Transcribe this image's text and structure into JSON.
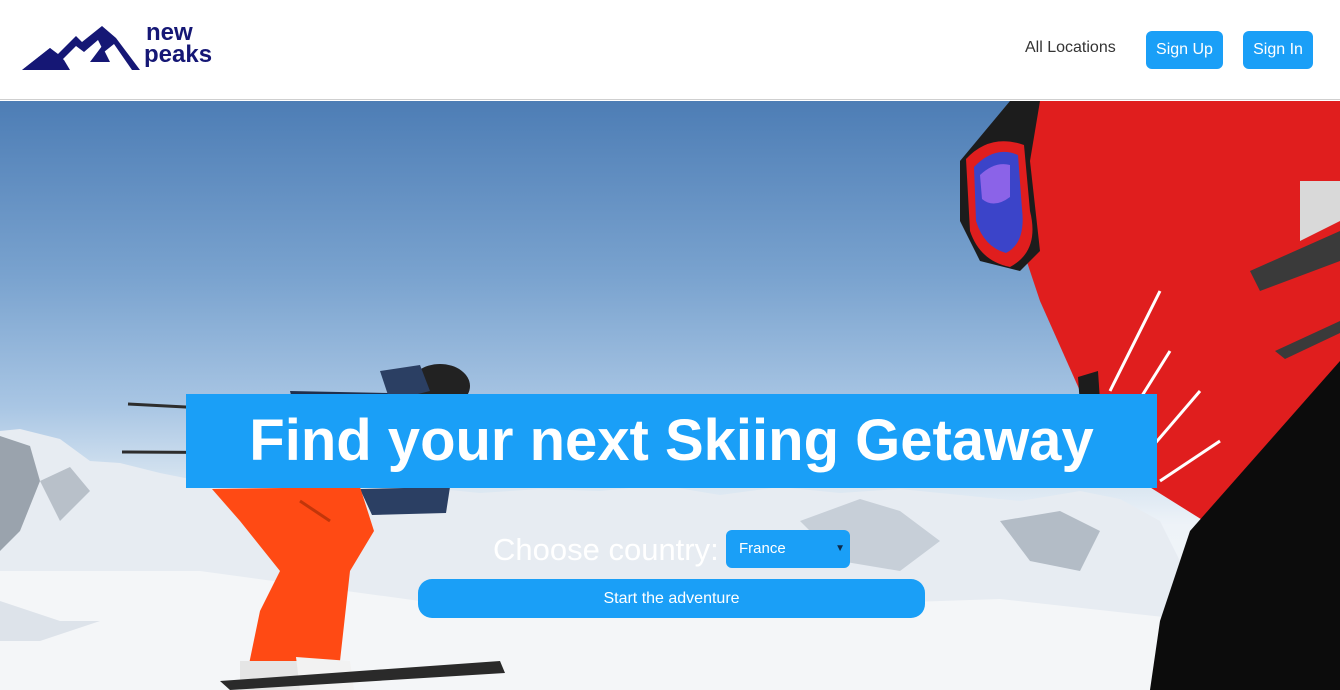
{
  "brand": {
    "line1": "new",
    "line2": "peaks",
    "color": "#151775",
    "icon": "mountain-logo"
  },
  "nav": {
    "all_locations": "All Locations",
    "sign_up": "Sign Up",
    "sign_in": "Sign In"
  },
  "hero": {
    "headline": "Find your next Skiing Getaway",
    "choose_label": "Choose country:",
    "country_selected": "France",
    "start_button": "Start the adventure"
  },
  "colors": {
    "accent": "#1a9ff7",
    "brand": "#151775",
    "jacket": "#e01e1e",
    "pants": "#ff4a14"
  }
}
